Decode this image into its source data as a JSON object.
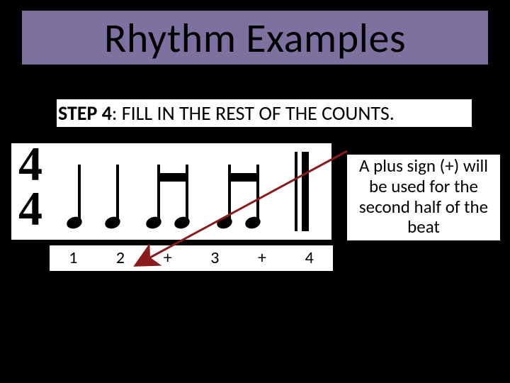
{
  "title": "Rhythm Examples",
  "step": {
    "bold": "STEP 4",
    "rest": ": FILL IN THE REST OF THE COUNTS."
  },
  "time_signature": {
    "top": "4",
    "bottom": "4"
  },
  "notation": {
    "sequence": [
      "quarter",
      "quarter",
      "eighth-pair",
      "eighth-pair"
    ]
  },
  "counts": [
    "1",
    "2",
    "+",
    "3",
    "+",
    "4"
  ],
  "explain": "A plus sign (+) will be used  for the second half of the beat",
  "colors": {
    "title_bg": "#7d71a0"
  }
}
